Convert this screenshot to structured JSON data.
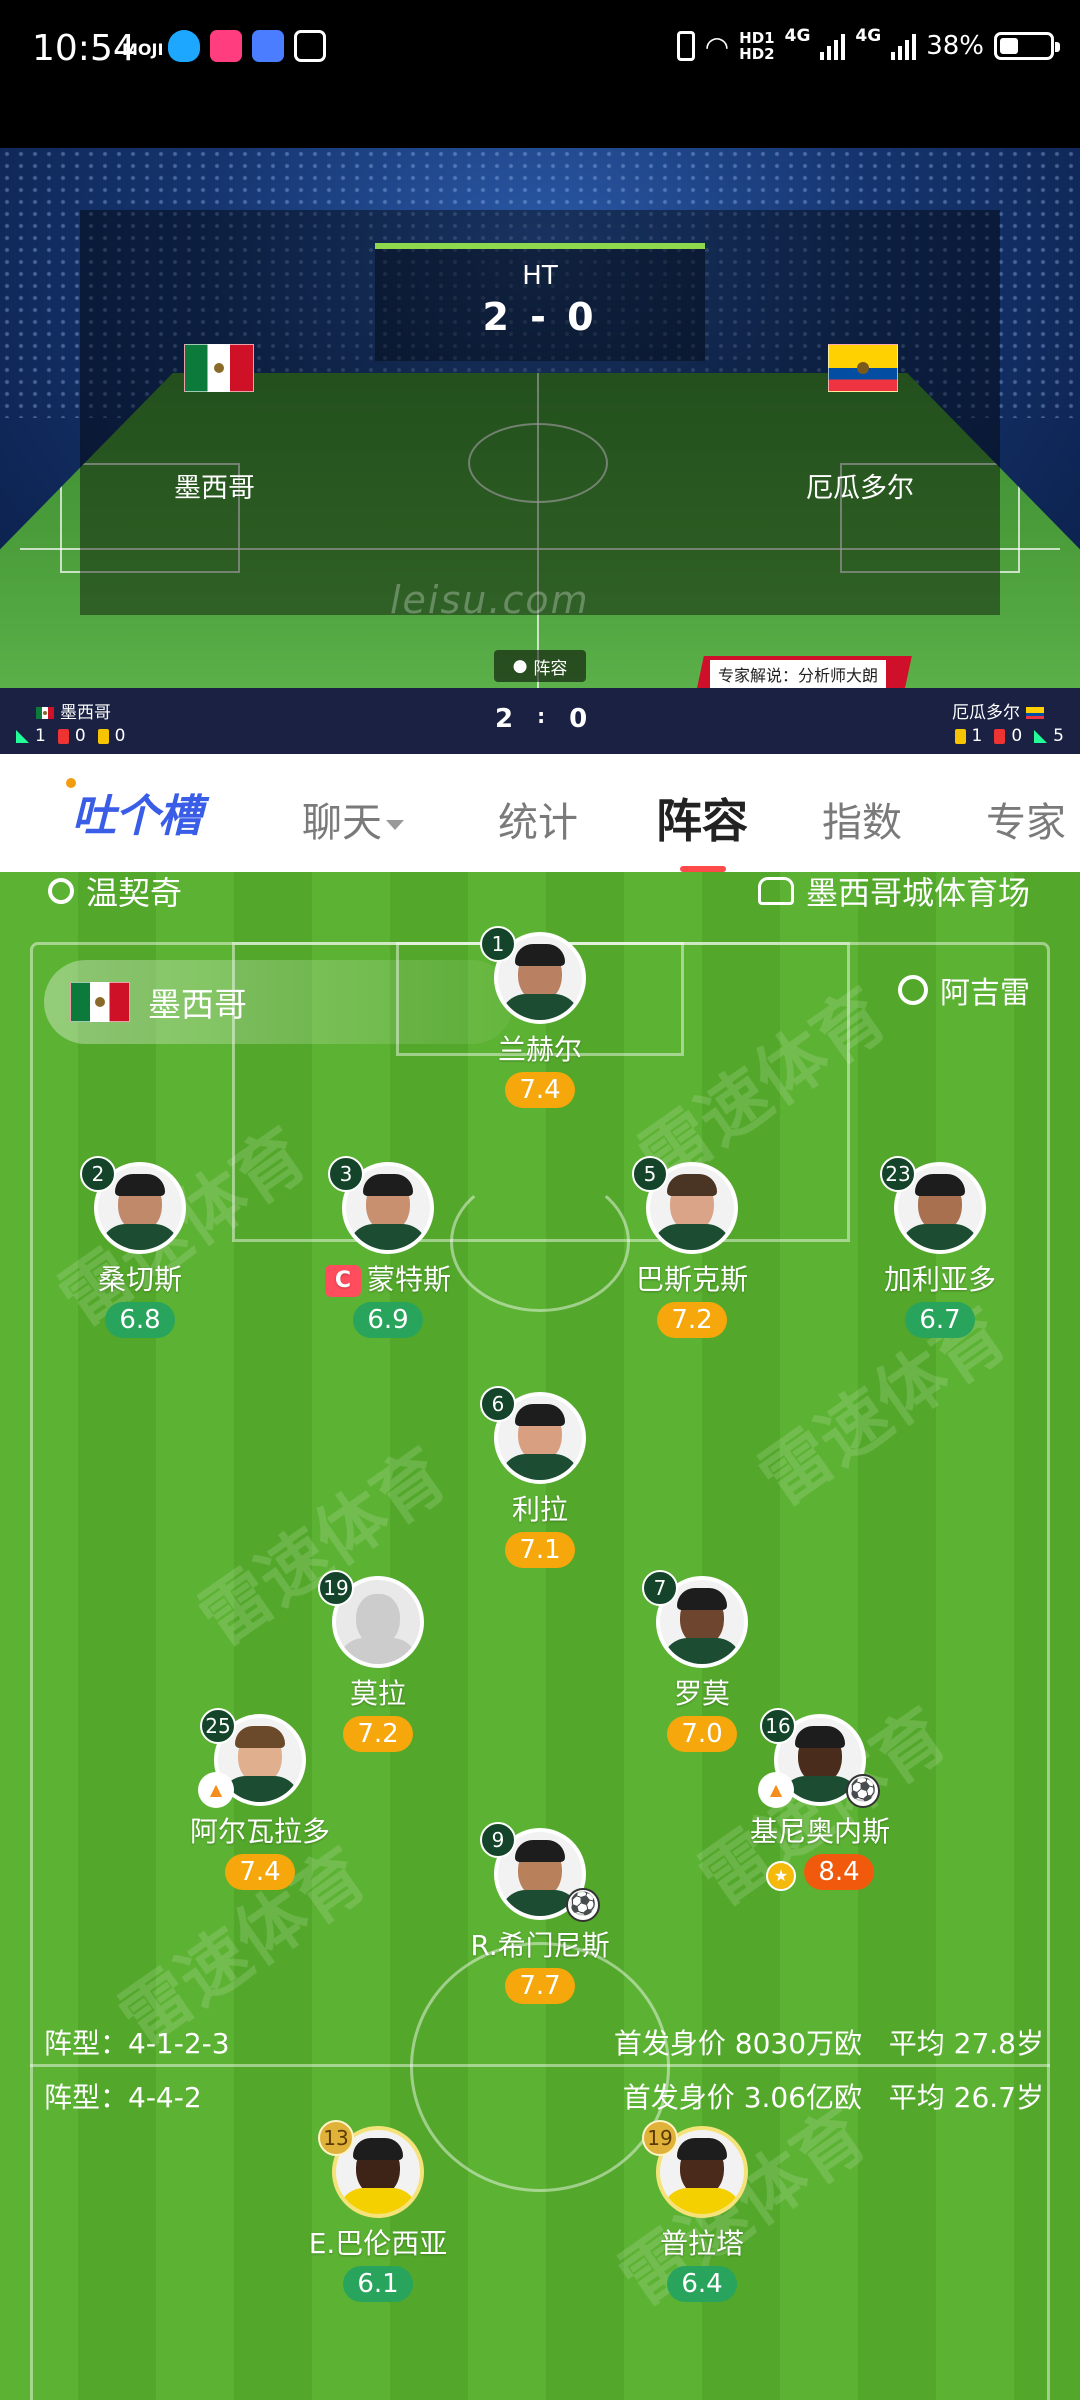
{
  "status_bar": {
    "time": "10:54",
    "moji": "MOJI",
    "hd1": "HD1",
    "hd2": "HD2",
    "net1": "4G",
    "net2": "4G",
    "battery": "38%"
  },
  "match": {
    "status": "HT",
    "score": "2 - 0",
    "home_team": "墨西哥",
    "away_team": "厄瓜多尔",
    "watermark": "leisu.com",
    "lineup_chip": "阵容",
    "expert_label": "专家解说：分析师大朗"
  },
  "mini_score": {
    "home_team": "墨西哥",
    "away_team": "厄瓜多尔",
    "home_goals": "2",
    "away_goals": "0",
    "separator": ":",
    "home_corners": "1",
    "home_red": "0",
    "home_yellow": "0",
    "away_yellow": "1",
    "away_red": "0",
    "away_corners": "5"
  },
  "tabs": {
    "logo": "吐个槽",
    "items": [
      "聊天",
      "统计",
      "阵容",
      "指数",
      "专家"
    ],
    "active": "阵容"
  },
  "lineup": {
    "referee": "温契奇",
    "venue": "墨西哥城体育场",
    "home_team": "墨西哥",
    "home_coach": "阿吉雷",
    "home_formation": "阵型：4-1-2-3",
    "home_value": "首发身价 8030万欧",
    "home_age": "平均 27.8岁",
    "away_formation": "阵型：4-4-2",
    "away_value": "首发身价 3.06亿欧",
    "away_age": "平均 26.7岁",
    "watermark_text": "雷速体育",
    "captain_badge": "C",
    "players": [
      {
        "number": "1",
        "name": "兰赫尔",
        "rating": "7.4",
        "rating_color": "orange"
      },
      {
        "number": "2",
        "name": "桑切斯",
        "rating": "6.8",
        "rating_color": "green"
      },
      {
        "number": "3",
        "name": "蒙特斯",
        "rating": "6.9",
        "rating_color": "green",
        "captain": true
      },
      {
        "number": "5",
        "name": "巴斯克斯",
        "rating": "7.2",
        "rating_color": "orange"
      },
      {
        "number": "23",
        "name": "加利亚多",
        "rating": "6.7",
        "rating_color": "green"
      },
      {
        "number": "6",
        "name": "利拉",
        "rating": "7.1",
        "rating_color": "orange"
      },
      {
        "number": "19",
        "name": "莫拉",
        "rating": "7.2",
        "rating_color": "orange"
      },
      {
        "number": "7",
        "name": "罗莫",
        "rating": "7.0",
        "rating_color": "orange"
      },
      {
        "number": "25",
        "name": "阿尔瓦拉多",
        "rating": "7.4",
        "rating_color": "orange"
      },
      {
        "number": "16",
        "name": "基尼奥内斯",
        "rating": "8.4",
        "rating_color": "red"
      },
      {
        "number": "9",
        "name": "R.希门尼斯",
        "rating": "7.7",
        "rating_color": "orange"
      }
    ],
    "away_players": [
      {
        "number": "13",
        "name": "E.巴伦西亚",
        "rating": "6.1",
        "rating_color": "green"
      },
      {
        "number": "19",
        "name": "普拉塔",
        "rating": "6.4",
        "rating_color": "green"
      }
    ]
  }
}
